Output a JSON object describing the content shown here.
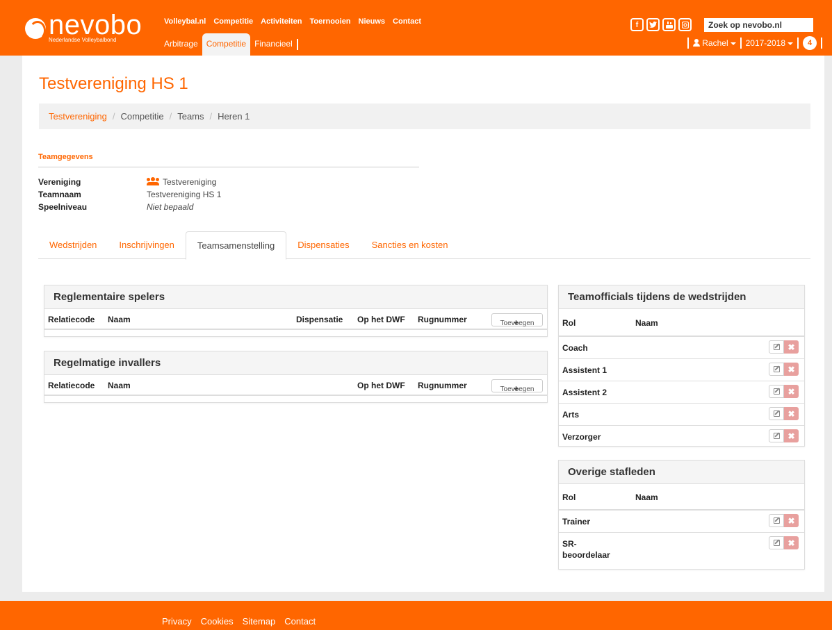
{
  "header": {
    "logo_text": "nevobo",
    "logo_sub": "Nederlandse Volleybalbond",
    "nav_primary": [
      "Volleybal.nl",
      "Competitie",
      "Activiteiten",
      "Toernooien",
      "Nieuws",
      "Contact"
    ],
    "nav_secondary": [
      "Arbitrage",
      "Competitie",
      "Financieel"
    ],
    "nav_secondary_active": "Competitie",
    "social": [
      "f",
      "t",
      "yt",
      "ig"
    ],
    "search_placeholder": "Zoek op nevobo.nl",
    "user_name": "Rachel",
    "season": "2017-2018",
    "notification_count": "4",
    "brand_color": "#ff6600"
  },
  "page": {
    "title": "Testvereniging HS 1",
    "breadcrumb": [
      "Testvereniging",
      "Competitie",
      "Teams",
      "Heren 1"
    ]
  },
  "team": {
    "section_title": "Teamgegevens",
    "rows": [
      {
        "key": "Vereniging",
        "value": "Testvereniging"
      },
      {
        "key": "Teamnaam",
        "value": "Testvereniging HS 1"
      },
      {
        "key": "Speelniveau",
        "value": "Niet bepaald"
      }
    ]
  },
  "tabs": [
    "Wedstrijden",
    "Inschrijvingen",
    "Teamsamenstelling",
    "Dispensaties",
    "Sancties en kosten"
  ],
  "tabs_active": "Teamsamenstelling",
  "players_panel": {
    "title": "Reglementaire spelers",
    "columns": [
      "Relatiecode",
      "Naam",
      "Dispensatie",
      "Op het DWF",
      "Rugnummer"
    ],
    "add_label": "Toevoegen"
  },
  "subs_panel": {
    "title": "Regelmatige invallers",
    "columns": [
      "Relatiecode",
      "Naam",
      "Op het DWF",
      "Rugnummer"
    ],
    "add_label": "Toevoegen"
  },
  "officials_panel": {
    "title": "Teamofficials tijdens de wedstrijden",
    "columns": [
      "Rol",
      "Naam"
    ],
    "rows": [
      "Coach",
      "Assistent 1",
      "Assistent 2",
      "Arts",
      "Verzorger"
    ]
  },
  "staff_panel": {
    "title": "Overige stafleden",
    "columns": [
      "Rol",
      "Naam"
    ],
    "rows": [
      "Trainer",
      "SR-\nbeoordelaar"
    ]
  },
  "footer": {
    "links": [
      "Privacy",
      "Cookies",
      "Sitemap",
      "Contact"
    ]
  },
  "icons": {
    "delete": "✖"
  }
}
